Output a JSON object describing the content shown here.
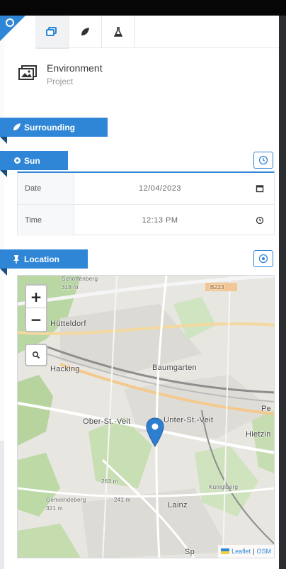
{
  "tabs": [
    {
      "icon": "layers-icon",
      "active": true
    },
    {
      "icon": "leaf-icon",
      "active": false
    },
    {
      "icon": "flask-icon",
      "active": false
    }
  ],
  "project": {
    "title": "Environment",
    "subtitle": "Project"
  },
  "sections": {
    "surrounding": "Surrounding",
    "sun": "Sun",
    "location": "Location"
  },
  "sun": {
    "date_label": "Date",
    "date_value": "12/04/2023",
    "time_label": "Time",
    "time_value": "12:13 PM"
  },
  "map": {
    "zoom_in": "+",
    "zoom_out": "−",
    "labels": {
      "huetteldorf": "Hütteldorf",
      "hacking": "Hacking",
      "baumgarten": "Baumgarten",
      "ober_st_veit": "Ober-St.-Veit",
      "unter_st_veit": "Unter-St.-Veit",
      "hietzing": "Hietzin",
      "lainz": "Lainz",
      "road_b223": "B223",
      "peak_263": "263 m",
      "peak_241": "241 m",
      "peak_321": "321 m",
      "hill_kuenigberg": "Küniglberg",
      "hill_gemeindeberg": "Gemeindeberg",
      "top_label": "Schottenberg",
      "top_elev": "318 m",
      "sp": "Sp",
      "pe": "Pe"
    },
    "attribution": {
      "leaflet": "Leaflet",
      "separator": "|",
      "osm": "OSM"
    }
  },
  "colors": {
    "accent": "#2f86d6",
    "accent_dark": "#1a4e80"
  }
}
